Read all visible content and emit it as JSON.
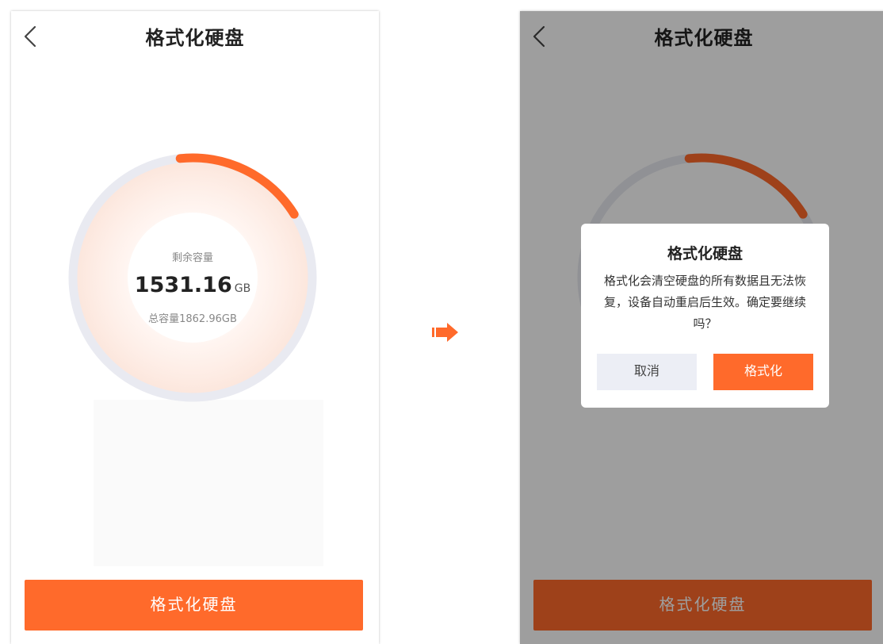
{
  "left_screen": {
    "header": {
      "title": "格式化硬盘"
    },
    "storage": {
      "remaining_label": "剩余容量",
      "remaining_value": "1531.16",
      "remaining_unit": "GB",
      "total_text": "总容量1862.96GB",
      "used_fraction": 0.178
    },
    "format_button_label": "格式化硬盘"
  },
  "right_screen": {
    "header": {
      "title": "格式化硬盘"
    },
    "dialog": {
      "title": "格式化硬盘",
      "message": "格式化会清空硬盘的所有数据且无法恢复，设备自动重启后生效。确定要继续吗？",
      "cancel_label": "取消",
      "confirm_label": "格式化"
    },
    "format_button_label": "格式化硬盘"
  },
  "colors": {
    "accent": "#ff6a2b",
    "ring_track": "#e9eaf1",
    "overlay": "rgba(0,0,0,0.38)"
  },
  "icons": {
    "back": "chevron-left-icon",
    "transition": "right-arrow-icon"
  }
}
